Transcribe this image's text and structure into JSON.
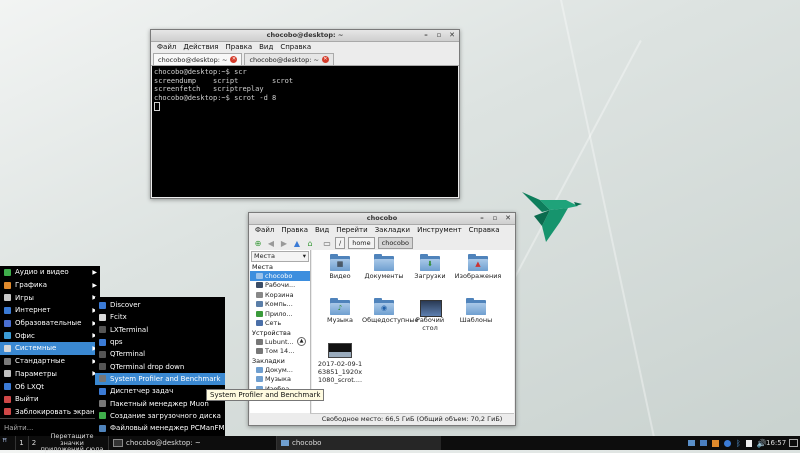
{
  "terminal": {
    "title": "chocobo@desktop: ~",
    "menu": [
      "Файл",
      "Действия",
      "Правка",
      "Вид",
      "Справка"
    ],
    "tabs": [
      {
        "label": "chocobo@desktop: ~"
      },
      {
        "label": "chocobo@desktop: ~"
      }
    ],
    "lines": [
      "chocobo@desktop:~$ scr",
      "screendump    script        scrot",
      "screenfetch   scriptreplay",
      "chocobo@desktop:~$ scrot -d 8"
    ]
  },
  "filemanager": {
    "title": "chocobo",
    "menu": [
      "Файл",
      "Правка",
      "Вид",
      "Перейти",
      "Закладки",
      "Инструмент",
      "Справка"
    ],
    "path": [
      "/",
      "home",
      "chocobo"
    ],
    "side_mode": "Места",
    "sections": {
      "places": "Места",
      "devices": "Устройства",
      "bookmarks": "Закладки"
    },
    "places": [
      "chocobo",
      "Рабочи...",
      "Корзина",
      "Компь...",
      "Прило...",
      "Сеть"
    ],
    "devices": [
      "Lubunt...",
      "Том 14..."
    ],
    "bookmarks": [
      "Докум...",
      "Музыка",
      "Изобра..."
    ],
    "files": [
      {
        "label": "Видео",
        "icon": "video-folder-icon"
      },
      {
        "label": "Документы",
        "icon": "folder-icon"
      },
      {
        "label": "Загрузки",
        "icon": "downloads-folder-icon"
      },
      {
        "label": "Изображения",
        "icon": "pictures-folder-icon"
      },
      {
        "label": "Музыка",
        "icon": "music-folder-icon"
      },
      {
        "label": "Общедоступные",
        "icon": "public-folder-icon"
      },
      {
        "label": "Рабочий стол",
        "icon": "desktop-folder-icon"
      },
      {
        "label": "Шаблоны",
        "icon": "templates-folder-icon"
      },
      {
        "label": "2017-02-09-163851_1920x1080_scrot....",
        "icon": "image-file-icon"
      }
    ],
    "status": "Свободное место: 66,5 ГиБ (Общий объем: 70,2 ГиБ)"
  },
  "start_menu": {
    "items": [
      {
        "label": "Аудио и видео",
        "icon": "multimedia-icon",
        "color": "#3fae4b"
      },
      {
        "label": "Графика",
        "icon": "graphics-icon",
        "color": "#e08a2c"
      },
      {
        "label": "Игры",
        "icon": "games-icon",
        "color": "#c7c7c7"
      },
      {
        "label": "Интернет",
        "icon": "internet-icon",
        "color": "#3b7bd6"
      },
      {
        "label": "Образовательные",
        "icon": "education-icon",
        "color": "#4a6fd1"
      },
      {
        "label": "Офис",
        "icon": "office-icon",
        "color": "#3b9cd6"
      },
      {
        "label": "Системные",
        "icon": "system-icon",
        "color": "#d8d8d8"
      },
      {
        "label": "Стандартные",
        "icon": "accessories-icon",
        "color": "#7a7a7a"
      },
      {
        "label": "Параметры",
        "icon": "preferences-icon",
        "color": "#c0c0c0"
      },
      {
        "label": "Об LXQt",
        "icon": "lxqt-icon",
        "color": "#3b7bd6"
      },
      {
        "label": "Выйти",
        "icon": "logout-icon",
        "color": "#d04848"
      },
      {
        "label": "Заблокировать экран",
        "icon": "lock-icon",
        "color": "#d04848"
      }
    ],
    "search_placeholder": "Найти...",
    "submenu": [
      {
        "label": "Discover",
        "icon": "discover-icon",
        "color": "#3b7bd6"
      },
      {
        "label": "Fcitx",
        "icon": "fcitx-icon",
        "color": "#d8d8d8"
      },
      {
        "label": "LXTerminal",
        "icon": "terminal-icon",
        "color": "#555555"
      },
      {
        "label": "qps",
        "icon": "qps-icon",
        "color": "#3b7bd6"
      },
      {
        "label": "QTerminal",
        "icon": "terminal-icon",
        "color": "#555555"
      },
      {
        "label": "QTerminal drop down",
        "icon": "terminal-icon",
        "color": "#555555"
      },
      {
        "label": "System Profiler and Benchmark",
        "icon": "profiler-icon",
        "color": "#777777"
      },
      {
        "label": "Диспетчер задач",
        "icon": "task-manager-icon",
        "color": "#3b7bd6"
      },
      {
        "label": "Пакетный менеджер Muon",
        "icon": "package-icon",
        "color": "#777777"
      },
      {
        "label": "Создание загрузочного диска",
        "icon": "usb-icon",
        "color": "#3fae4b"
      },
      {
        "label": "Файловый менеджер PCManFM",
        "icon": "file-manager-icon",
        "color": "#4f83bb"
      }
    ]
  },
  "tooltip": "System Profiler and Benchmark",
  "taskbar": {
    "desktops": [
      "1",
      "2"
    ],
    "hint": "Перетащите значки приложений сюда",
    "tasks": [
      {
        "label": "chocobo@desktop: ~",
        "icon": "terminal-icon"
      },
      {
        "label": "chocobo",
        "icon": "folder-icon"
      }
    ],
    "clock": "16:57"
  },
  "colors": {
    "accent": "#3a88d1",
    "bird": "#1fa37a"
  }
}
